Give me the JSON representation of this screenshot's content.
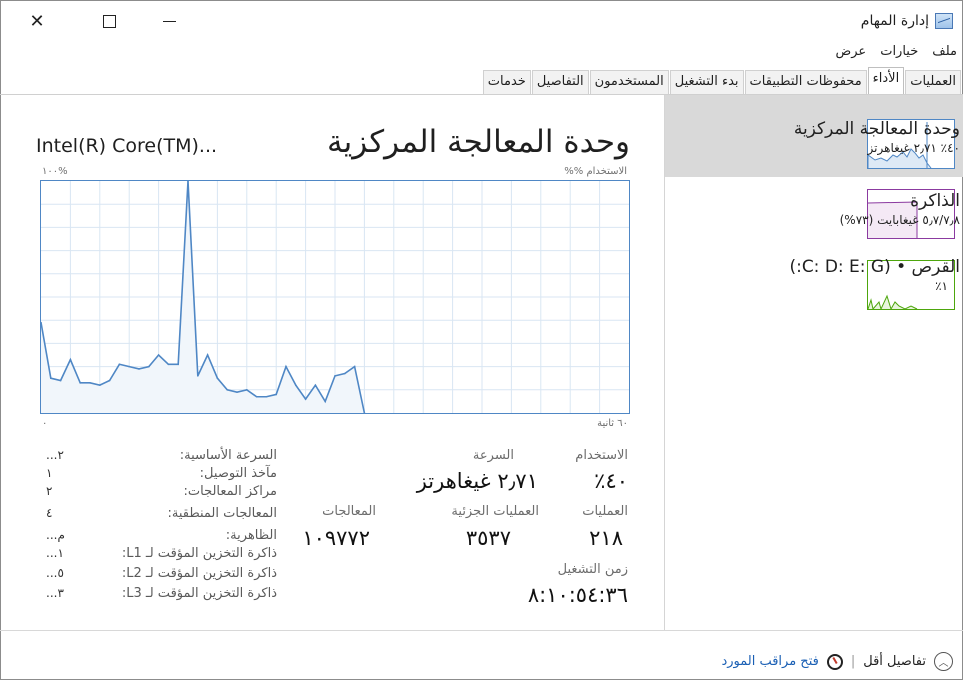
{
  "window": {
    "title": "إدارة المهام"
  },
  "menu": [
    "ملف",
    "خيارات",
    "عرض"
  ],
  "tabs": [
    {
      "label": "العمليات",
      "active": false
    },
    {
      "label": "الأداء",
      "active": true
    },
    {
      "label": "محفوظات التطبيقات",
      "active": false
    },
    {
      "label": "بدء التشغيل",
      "active": false
    },
    {
      "label": "المستخدمون",
      "active": false
    },
    {
      "label": "التفاصيل",
      "active": false
    },
    {
      "label": "خدمات",
      "active": false
    }
  ],
  "sidebar": {
    "cpu": {
      "name": "وحدة المعالجة المركزية",
      "sub": "٤٠٪ ٢٫٧١ غيغاهرتز"
    },
    "memory": {
      "name": "الذاكرة",
      "sub": "٥٫٧/٧٫٨ غيغابايت (٧٣%)"
    },
    "disk": {
      "name": "القرص • (C: D: E: G:)",
      "sub": "١٪"
    }
  },
  "main": {
    "title": "وحدة المعالجة المركزية",
    "cpu_model": "Intel(R) Core(TM)...",
    "usage_label": "الاستخدام %%",
    "max_label": "١٠٠%",
    "time_label": "٦٠ ثانية",
    "min_label": "٠"
  },
  "chart_data": {
    "type": "area",
    "xlabel": "٦٠ ثانية",
    "ylabel": "الاستخدام %%",
    "ylim": [
      0,
      100
    ],
    "x_seconds_ago": [
      60,
      59,
      58,
      57,
      56,
      55,
      54,
      53,
      52,
      51,
      50,
      49,
      48,
      47,
      46,
      45,
      44,
      43,
      42,
      41,
      40,
      39,
      38,
      37,
      36,
      35,
      34,
      33,
      32,
      31,
      30,
      29,
      28,
      27,
      26,
      25,
      24,
      23,
      22,
      21,
      20
    ],
    "values": [
      39,
      15,
      14,
      23,
      13,
      13,
      12,
      14,
      21,
      20,
      19,
      20,
      25,
      21,
      21,
      100,
      16,
      25,
      15,
      10,
      9,
      10,
      7,
      7,
      8,
      20,
      12,
      6,
      12,
      5,
      16,
      17,
      20,
      0,
      0,
      0,
      0,
      0,
      0,
      0,
      0
    ],
    "grid": true
  },
  "stats": {
    "usage": {
      "label": "الاستخدام",
      "value": "٤٠٪"
    },
    "speed": {
      "label": "السرعة",
      "value": "٢٫٧١ غيغاهرتز"
    },
    "processes": {
      "label": "العمليات",
      "value": "٢١٨"
    },
    "threads": {
      "label": "العمليات الجزئية",
      "value": "٣٥٣٧"
    },
    "handles": {
      "label": "المعالجات",
      "value": "١٠٩٧٧٢"
    },
    "uptime": {
      "label": "زمن التشغيل",
      "value": "٨:١٠:٥٤:٣٦"
    }
  },
  "specs": [
    {
      "label": "السرعة الأساسية:",
      "value": "...٢"
    },
    {
      "label": "مآخذ التوصيل:",
      "value": "١"
    },
    {
      "label": "مراكز المعالجات:",
      "value": "٢"
    },
    {
      "label": "المعالجات المنطقية:",
      "value": "٤"
    },
    {
      "label": "الظاهرية:",
      "value": "...م"
    },
    {
      "label": "ذاكرة التخزين المؤقت لـ L1:",
      "value": "...١"
    },
    {
      "label": "ذاكرة التخزين المؤقت لـ L2:",
      "value": "...٥"
    },
    {
      "label": "ذاكرة التخزين المؤقت لـ L3:",
      "value": "...٣"
    }
  ],
  "footer": {
    "fewer_details": "تفاصيل أقل",
    "open_monitor": "فتح مراقب المورد"
  },
  "colors": {
    "cpu_line": "#4f87c5",
    "cpu_fill": "#f1f6fb",
    "memory": "#8b3aa0",
    "disk": "#4da60c",
    "selected": "#d9d9d9"
  }
}
